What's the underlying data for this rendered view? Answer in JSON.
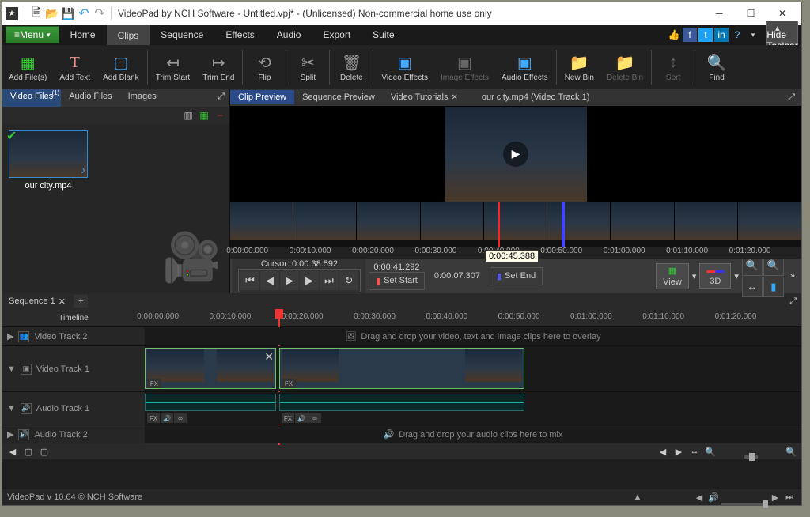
{
  "titlebar": {
    "title": "VideoPad by NCH Software - Untitled.vpj* - (Unlicensed) Non-commercial home use only"
  },
  "menubar": {
    "menu_label": "Menu",
    "items": [
      "Home",
      "Clips",
      "Sequence",
      "Effects",
      "Audio",
      "Export",
      "Suite"
    ],
    "hide_toolbar": "Hide Toolbar"
  },
  "toolbar": {
    "items": [
      {
        "label": "Add File(s)",
        "icon": "📄",
        "dim": false
      },
      {
        "label": "Add Text",
        "icon": "T",
        "dim": false
      },
      {
        "label": "Add Blank",
        "icon": "▢",
        "dim": false
      },
      {
        "sep": true
      },
      {
        "label": "Trim Start",
        "icon": "⟵",
        "dim": false
      },
      {
        "label": "Trim End",
        "icon": "⟶",
        "dim": false
      },
      {
        "sep": true
      },
      {
        "label": "Flip",
        "icon": "↔",
        "dim": false
      },
      {
        "sep": true
      },
      {
        "label": "Split",
        "icon": "✂",
        "dim": false
      },
      {
        "sep": true
      },
      {
        "label": "Delete",
        "icon": "🗑",
        "dim": false
      },
      {
        "sep": true
      },
      {
        "label": "Video Effects",
        "icon": "FX",
        "dim": false
      },
      {
        "label": "Image Effects",
        "icon": "FX",
        "dim": true
      },
      {
        "label": "Audio Effects",
        "icon": "FX",
        "dim": false
      },
      {
        "sep": true
      },
      {
        "label": "New Bin",
        "icon": "+",
        "dim": false
      },
      {
        "label": "Delete Bin",
        "icon": "−",
        "dim": true
      },
      {
        "sep": true
      },
      {
        "label": "Sort",
        "icon": "↕",
        "dim": true
      },
      {
        "sep": true
      },
      {
        "label": "Find",
        "icon": "🔍",
        "dim": false
      }
    ]
  },
  "left_pane": {
    "tabs": [
      "Video Files",
      "Audio Files",
      "Images"
    ],
    "tab_badge": "(1)",
    "clip": {
      "name": "our city.mp4"
    }
  },
  "right_pane": {
    "tabs": [
      {
        "label": "Clip Preview",
        "active": true
      },
      {
        "label": "Sequence Preview"
      },
      {
        "label": "Video Tutorials",
        "close": true
      }
    ],
    "clip_title": "our city.mp4 (Video Track 1)",
    "strip_times": [
      "0:00:00.000",
      "0:00:10.000",
      "0:00:20.000",
      "0:00:30.000",
      "0:00:40.000",
      "0:00:50.000",
      "0:01:00.000",
      "0:01:10.000",
      "0:01:20.000"
    ],
    "cursor_label": "Cursor:",
    "cursor_time": "0:00:38.592",
    "start_time": "0:00:41.292",
    "set_start": "Set Start",
    "duration": "0:00:07.307",
    "set_end": "Set End",
    "tooltip": "0:00:45.388",
    "view_label": "View",
    "three_d_label": "3D"
  },
  "timeline": {
    "sequence_tab": "Sequence 1",
    "timeline_label": "Timeline",
    "ruler": [
      "0:00:00.000",
      "0:00:10.000",
      "0:00:20.000",
      "0:00:30.000",
      "0:00:40.000",
      "0:00:50.000",
      "0:01:00.000",
      "0:01:10.000",
      "0:01:20.000"
    ],
    "tracks": {
      "vt2": {
        "label": "Video Track 2",
        "drop": "Drag and drop your video, text and image clips here to overlay"
      },
      "vt1": {
        "label": "Video Track 1"
      },
      "at1": {
        "label": "Audio Track 1"
      },
      "at2": {
        "label": "Audio Track 2",
        "drop": "Drag and drop your audio clips here to mix"
      }
    }
  },
  "status": {
    "version": "VideoPad v 10.64 © NCH Software"
  }
}
